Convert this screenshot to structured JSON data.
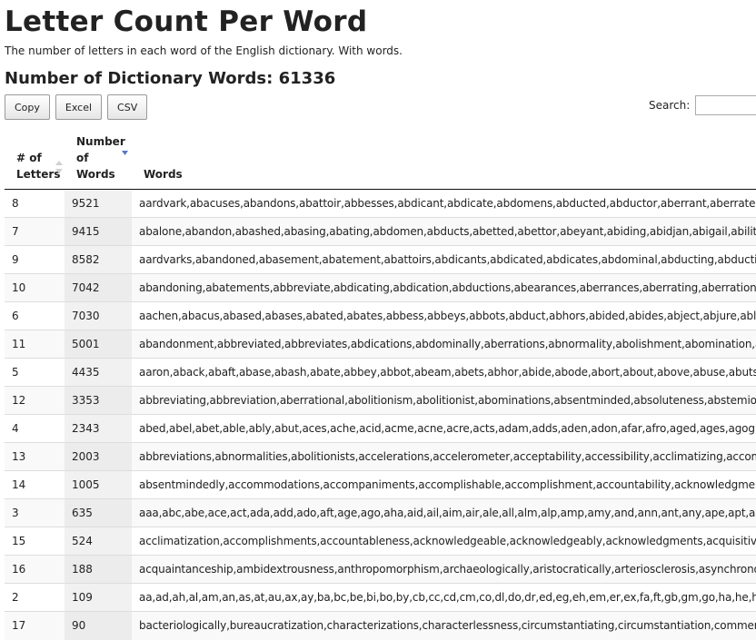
{
  "page": {
    "title": "Letter Count Per Word",
    "subtitle": "The number of letters in each word of the English dictionary. With words.",
    "count_heading": "Number of Dictionary Words: 61336"
  },
  "toolbar": {
    "copy_label": "Copy",
    "excel_label": "Excel",
    "csv_label": "CSV"
  },
  "search": {
    "label": "Search:",
    "value": ""
  },
  "table": {
    "headers": {
      "letters": [
        "# of",
        "Letters"
      ],
      "number": [
        "Number",
        "of",
        "Words"
      ],
      "words": "Words"
    },
    "sort": {
      "column": "Number of Words",
      "direction": "descending"
    },
    "rows": [
      {
        "letters": "8",
        "count": "9521",
        "words": "aardvark,abacuses,abandons,abattoir,abbesses,abdicant,abdicate,abdomens,abducted,abductor,aberrant,aberrate,abetting,abetto"
      },
      {
        "letters": "7",
        "count": "9415",
        "words": "abalone,abandon,abashed,abasing,abating,abdomen,abducts,abetted,abettor,abeyant,abiding,abidjan,abigail,ability,abjured,abjur"
      },
      {
        "letters": "9",
        "count": "8582",
        "words": "aardvarks,abandoned,abasement,abatement,abattoirs,abdicants,abdicated,abdicates,abdominal,abducting,abduction,abductors,ab"
      },
      {
        "letters": "10",
        "count": "7042",
        "words": "abandoning,abatements,abbreviate,abdicating,abdication,abductions,abearances,aberrances,aberrating,aberration,abhorrence,ab"
      },
      {
        "letters": "6",
        "count": "7030",
        "words": "aachen,abacus,abased,abases,abated,abates,abbess,abbeys,abbots,abduct,abhors,abided,abides,abject,abjure,ablaze,ablest,aboar"
      },
      {
        "letters": "11",
        "count": "5001",
        "words": "abandonment,abbreviated,abbreviates,abdications,abdominally,aberrations,abnormality,abolishment,abomination,abortionist,abo"
      },
      {
        "letters": "5",
        "count": "4435",
        "words": "aaron,aback,abaft,abase,abash,abate,abbey,abbot,abeam,abets,abhor,abide,abode,abort,about,above,abuse,abuts,abyss,accra,ach"
      },
      {
        "letters": "12",
        "count": "3353",
        "words": "abbreviating,abbreviation,aberrational,abolitionism,abolitionist,abominations,absentminded,absoluteness,abstemiously,abstracte"
      },
      {
        "letters": "4",
        "count": "2343",
        "words": "abed,abel,abet,able,ably,abut,aces,ache,acid,acme,acne,acre,acts,adam,adds,aden,adon,afar,afro,aged,ages,agog,ague,ahem,ahoy,"
      },
      {
        "letters": "13",
        "count": "2003",
        "words": "abbreviations,abnormalities,abolitionists,accelerations,accelerometer,acceptability,accessibility,acclimatizing,accommodating,acco"
      },
      {
        "letters": "14",
        "count": "1005",
        "words": "absentmindedly,accommodations,accompaniments,accomplishable,accomplishment,accountability,acknowledgment,administrati"
      },
      {
        "letters": "3",
        "count": "635",
        "words": "aaa,abc,abe,ace,act,ada,add,ado,aft,age,ago,aha,aid,ail,aim,air,ale,all,alm,alp,amp,amy,and,ann,ant,any,ape,apt,arc,are,ark,arm,art,as"
      },
      {
        "letters": "15",
        "count": "524",
        "words": "acclimatization,accomplishments,accountableness,acknowledgeable,acknowledgeably,acknowledgments,acquisitiveness,administ"
      },
      {
        "letters": "16",
        "count": "188",
        "words": "acquaintanceship,ambidextrousness,anthropomorphism,archaeologically,aristocratically,arteriosclerosis,asynchronousness,autobio"
      },
      {
        "letters": "2",
        "count": "109",
        "words": "aa,ad,ah,al,am,an,as,at,au,ax,ay,ba,bc,be,bi,bo,by,cb,cc,cd,cm,co,dl,do,dr,ed,eg,eh,em,er,ex,fa,ft,gb,gm,go,ha,he,hi,ho,ie,if,ii,in,is,it,iv,ix"
      },
      {
        "letters": "17",
        "count": "90",
        "words": "bacteriologically,bureaucratization,characterizations,characterlessness,circumstantiating,circumstantiation,commercialization,comm"
      }
    ]
  }
}
